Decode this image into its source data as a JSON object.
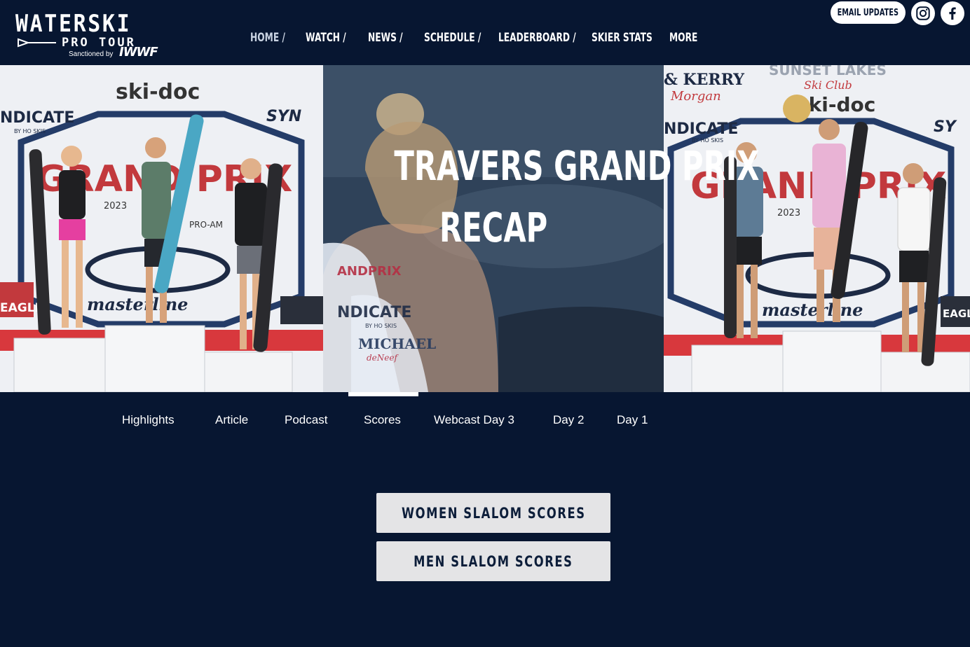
{
  "header": {
    "logo": {
      "main": "WATERSKI",
      "sub": "PRO TOUR",
      "sanctioned": "Sanctioned by",
      "iwwf": "IWWF"
    },
    "nav": [
      {
        "label": "Home /",
        "active": true
      },
      {
        "label": "Watch /"
      },
      {
        "label": "News /"
      },
      {
        "label": "Schedule /"
      },
      {
        "label": "Leaderboard /"
      },
      {
        "label": "Skier Stats"
      },
      {
        "label": "More"
      }
    ],
    "email_button": "Email Updates",
    "social": [
      {
        "icon": "instagram-icon"
      },
      {
        "icon": "facebook-icon"
      }
    ]
  },
  "hero": {
    "title_line1": "TRAVERS GRAND PRIX",
    "title_line2": "RECAP",
    "left_banner": {
      "top": "ski-doc",
      "left": "NDICATE",
      "sub": "BY HO SKIS",
      "brand": "masterline",
      "grand_prix": "GRAND PRIX",
      "year": "2023",
      "eagle": "EAGLE",
      "synergy": "SYN",
      "pro_am": "PRO-AM"
    },
    "center_photo": {
      "jersey_top": "ANDPRIX",
      "jersey_mid": "NDICATE",
      "jersey_sub": "BY HO SKIS",
      "name": "MICHAEL",
      "name2": "deNeef"
    },
    "right_banner": {
      "top": "ski-doc",
      "left": "NDICATE",
      "sub": "BY HO SKIS",
      "brand": "masterline",
      "grand_prix": "GRAND PRIX",
      "year": "2023",
      "eagle": "EAGLE",
      "sponsor": "& KERRY",
      "sponsor2": "Morgan",
      "club": "SUNSET LAKES",
      "club2": "Ski Club",
      "synergy": "SY"
    }
  },
  "tabs": {
    "items": [
      "Highlights",
      "Article",
      "Podcast",
      "Scores",
      "Webcast Day 3",
      "Day 2",
      "Day 1"
    ],
    "active_index": 3
  },
  "scores": {
    "women": "Women Slalom Scores",
    "men": "Men Slalom Scores"
  },
  "colors": {
    "background": "#071631",
    "button_bg": "#e4e4e6",
    "button_text": "#0d1e3a"
  }
}
